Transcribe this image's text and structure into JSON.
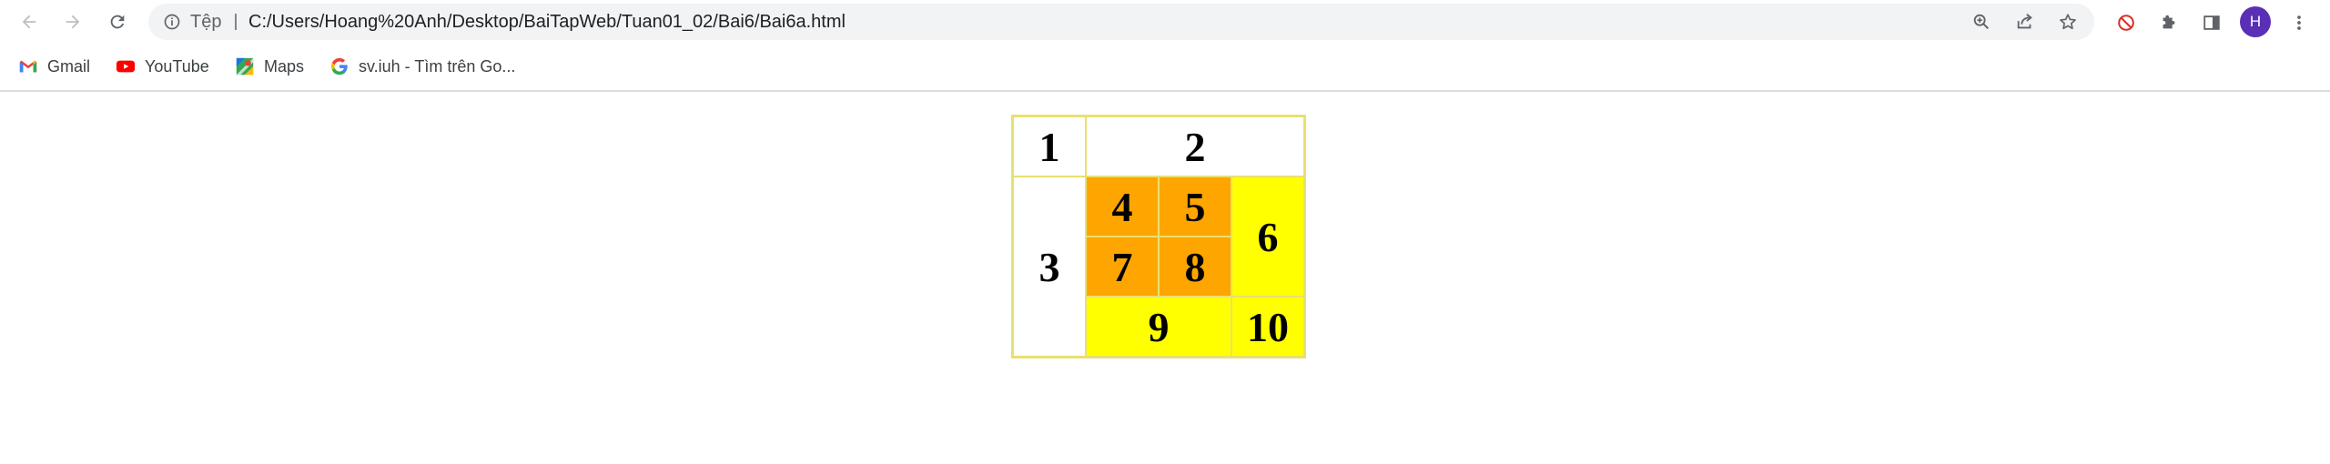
{
  "browser": {
    "nav": {
      "back_icon": "arrow-left-icon",
      "forward_icon": "arrow-right-icon",
      "reload_icon": "reload-icon"
    },
    "omnibox": {
      "scheme_label": "Tệp",
      "url": "C:/Users/Hoang%20Anh/Desktop/BaiTapWeb/Tuan01_02/Bai6/Bai6a.html"
    },
    "profile_initial": "H",
    "colors": {
      "avatar": "#5a2fb5",
      "blocked_icon": "#d93025"
    }
  },
  "bookmarks": [
    {
      "label": "Gmail",
      "icon": "gmail-icon"
    },
    {
      "label": "YouTube",
      "icon": "youtube-icon"
    },
    {
      "label": "Maps",
      "icon": "maps-icon"
    },
    {
      "label": "sv.iuh - Tìm trên Go...",
      "icon": "google-icon"
    }
  ],
  "table": {
    "cells": {
      "c1": "1",
      "c2": "2",
      "c3": "3",
      "c4": "4",
      "c5": "5",
      "c6": "6",
      "c7": "7",
      "c8": "8",
      "c9": "9",
      "c10": "10"
    },
    "colors": {
      "border": "#e8e070",
      "orange": "#ffa500",
      "yellow": "#ffff00",
      "white": "#ffffff"
    }
  }
}
